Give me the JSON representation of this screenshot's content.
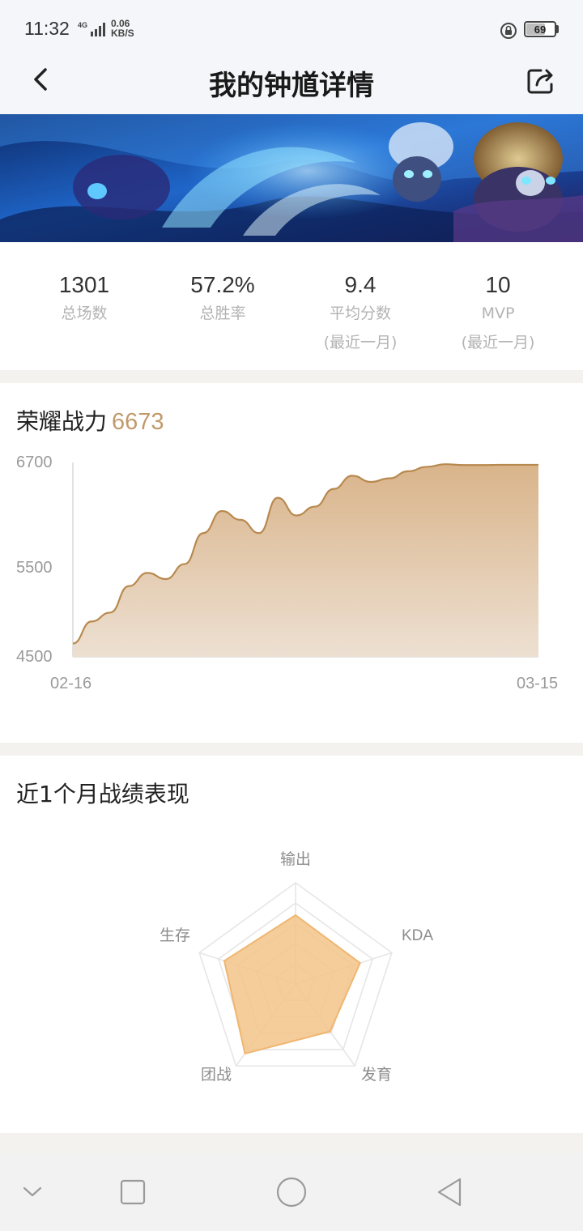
{
  "status_bar": {
    "time": "11:32",
    "network": "4G",
    "speed_value": "0.06",
    "speed_unit": "KB/S",
    "battery": "69",
    "battery_level": 0.69,
    "icons": [
      "signal-icon",
      "rotation-lock-icon",
      "battery-icon"
    ]
  },
  "header": {
    "title": "我的钟馗详情",
    "back_icon": "chevron-left-icon",
    "share_icon": "share-icon"
  },
  "stats": [
    {
      "value": "1301",
      "label": "总场数",
      "sublabel": ""
    },
    {
      "value": "57.2%",
      "label": "总胜率",
      "sublabel": ""
    },
    {
      "value": "9.4",
      "label": "平均分数",
      "sublabel": "(最近一月)"
    },
    {
      "value": "10",
      "label": "MVP",
      "sublabel": "(最近一月)"
    }
  ],
  "power": {
    "title": "荣耀战力",
    "value": "6673"
  },
  "chart_data": {
    "type": "area",
    "title": "荣耀战力",
    "x_start_label": "02-16",
    "x_end_label": "03-15",
    "y_ticks": [
      "6700",
      "5500",
      "4500"
    ],
    "ylim": [
      4500,
      6700
    ],
    "x": [
      0,
      4,
      8,
      12,
      16,
      20,
      24,
      28,
      32,
      36,
      40,
      44,
      48,
      52,
      56,
      60,
      64,
      68,
      72,
      76,
      80,
      84,
      88,
      92,
      96,
      100
    ],
    "values": [
      4650,
      4900,
      5000,
      5300,
      5450,
      5380,
      5550,
      5900,
      6150,
      6050,
      5900,
      6300,
      6100,
      6200,
      6400,
      6550,
      6480,
      6520,
      6600,
      6650,
      6680,
      6670,
      6670,
      6673,
      6673,
      6673
    ],
    "grid": false,
    "color": "#c09a6b"
  },
  "performance": {
    "title": "近1个月战绩表现",
    "radar": {
      "axes": [
        "输出",
        "KDA",
        "发育",
        "团战",
        "生存"
      ],
      "values": [
        0.68,
        0.67,
        0.58,
        0.85,
        0.74
      ],
      "fill_color": "#f2c48a",
      "stroke_color": "#f0b670"
    }
  },
  "nav": [
    "chevron-down-icon",
    "square-icon",
    "circle-icon",
    "triangle-back-icon"
  ]
}
